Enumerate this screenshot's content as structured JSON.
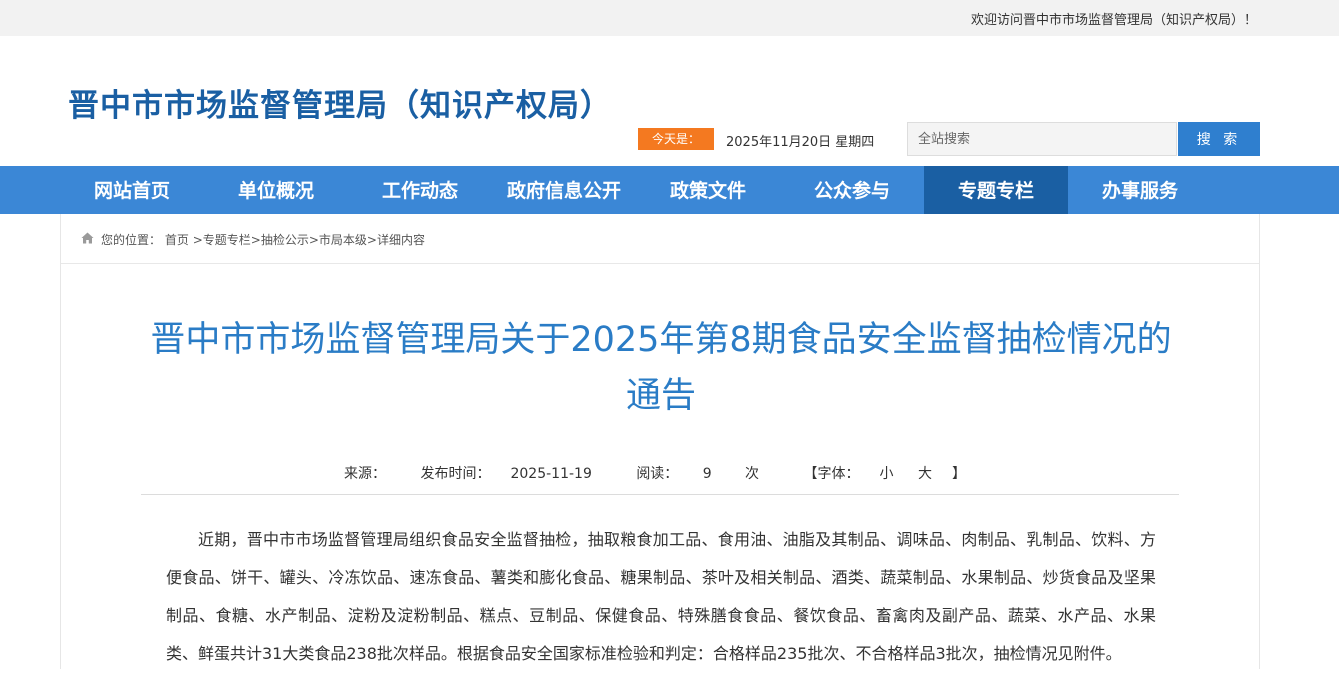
{
  "topbar": {
    "welcome": "欢迎访问晋中市市场监督管理局（知识产权局）！"
  },
  "header": {
    "site_title": "晋中市市场监督管理局（知识产权局）",
    "today_label": "今天是：",
    "date": "2025年11月20日 星期四",
    "search_placeholder": "全站搜索",
    "search_button": "搜 索"
  },
  "nav": {
    "items": [
      {
        "label": "网站首页"
      },
      {
        "label": "单位概况"
      },
      {
        "label": "工作动态"
      },
      {
        "label": "政府信息公开"
      },
      {
        "label": "政策文件"
      },
      {
        "label": "公众参与"
      },
      {
        "label": "专题专栏"
      },
      {
        "label": "办事服务"
      }
    ],
    "active_index": 6
  },
  "breadcrumb": {
    "prefix": "您的位置：",
    "items": [
      "首页",
      "专题专栏",
      "抽检公示",
      "市局本级",
      "详细内容"
    ],
    "separator": ">"
  },
  "article": {
    "title": "晋中市市场监督管理局关于2025年第8期食品安全监督抽检情况的通告",
    "source_label": "来源：",
    "publish_label": "发布时间：",
    "publish_date": "2025-11-19",
    "read_label": "阅读：",
    "read_count": "9",
    "read_unit": "次",
    "font_open": "【字体：",
    "font_small": "小",
    "font_large": "大",
    "font_close": "】",
    "body": "近期，晋中市市场监督管理局组织食品安全监督抽检，抽取粮食加工品、食用油、油脂及其制品、调味品、肉制品、乳制品、饮料、方便食品、饼干、罐头、冷冻饮品、速冻食品、薯类和膨化食品、糖果制品、茶叶及相关制品、酒类、蔬菜制品、水果制品、炒货食品及坚果制品、食糖、水产制品、淀粉及淀粉制品、糕点、豆制品、保健食品、特殊膳食食品、餐饮食品、畜禽肉及副产品、蔬菜、水产品、水果类、鲜蛋共计31大类食品238批次样品。根据食品安全国家标准检验和判定：合格样品235批次、不合格样品3批次，抽检情况见附件。"
  },
  "colors": {
    "brand_blue": "#1a5fa3",
    "nav_blue": "#3b87d6",
    "accent_orange": "#f47920",
    "title_blue": "#2a7cc6"
  }
}
